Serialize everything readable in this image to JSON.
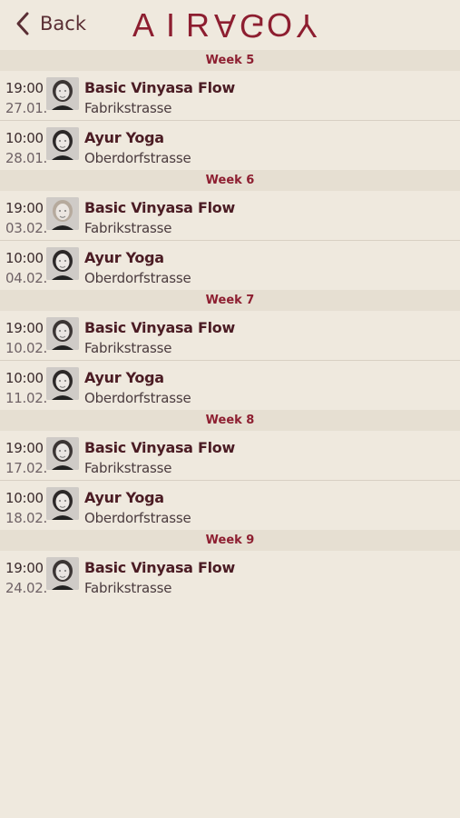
{
  "header": {
    "back_label": "Back",
    "logo_letters": [
      "A",
      "I",
      "R",
      "A",
      "G",
      "O",
      "Y"
    ]
  },
  "colors": {
    "accent": "#8d1e30",
    "background": "#efe9de",
    "week_band": "#e6dfd2"
  },
  "weeks": [
    {
      "label": "Week 5",
      "classes": [
        {
          "time": "19:00",
          "date": "27.01.",
          "title": "Basic Vinyasa Flow",
          "location": "Fabrikstrasse",
          "avatar": "instructor-dark-hair-icon"
        },
        {
          "time": "10:00",
          "date": "28.01.",
          "title": "Ayur Yoga",
          "location": "Oberdorfstrasse",
          "avatar": "instructor-curly-hair-icon"
        }
      ]
    },
    {
      "label": "Week 6",
      "classes": [
        {
          "time": "19:00",
          "date": "03.02.",
          "title": "Basic Vinyasa Flow",
          "location": "Fabrikstrasse",
          "avatar": "instructor-blonde-hair-icon"
        },
        {
          "time": "10:00",
          "date": "04.02.",
          "title": "Ayur Yoga",
          "location": "Oberdorfstrasse",
          "avatar": "instructor-curly-hair-icon"
        }
      ]
    },
    {
      "label": "Week 7",
      "classes": [
        {
          "time": "19:00",
          "date": "10.02.",
          "title": "Basic Vinyasa Flow",
          "location": "Fabrikstrasse",
          "avatar": "instructor-dark-hair-icon"
        },
        {
          "time": "10:00",
          "date": "11.02.",
          "title": "Ayur Yoga",
          "location": "Oberdorfstrasse",
          "avatar": "instructor-curly-hair-icon"
        }
      ]
    },
    {
      "label": "Week 8",
      "classes": [
        {
          "time": "19:00",
          "date": "17.02.",
          "title": "Basic Vinyasa Flow",
          "location": "Fabrikstrasse",
          "avatar": "instructor-dark-hair-icon"
        },
        {
          "time": "10:00",
          "date": "18.02.",
          "title": "Ayur Yoga",
          "location": "Oberdorfstrasse",
          "avatar": "instructor-curly-hair-icon"
        }
      ]
    },
    {
      "label": "Week 9",
      "classes": [
        {
          "time": "19:00",
          "date": "24.02.",
          "title": "Basic Vinyasa Flow",
          "location": "Fabrikstrasse",
          "avatar": "instructor-dark-hair-icon"
        }
      ]
    }
  ]
}
